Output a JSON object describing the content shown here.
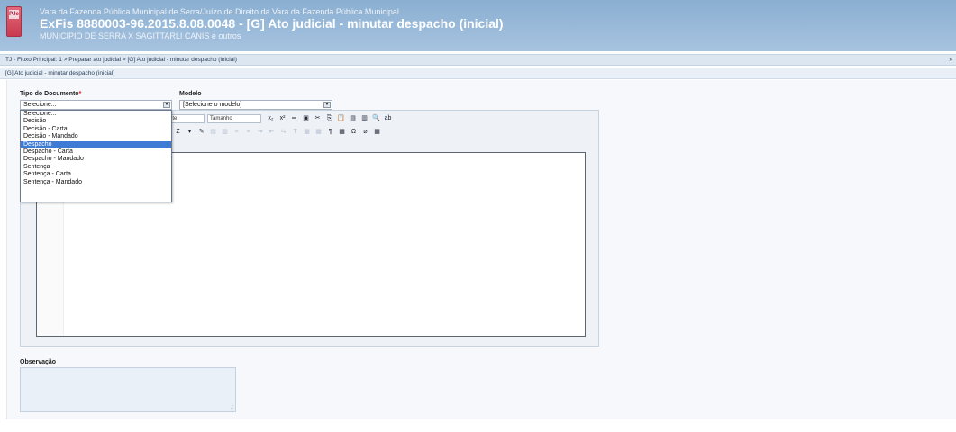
{
  "header": {
    "subtitle": "Vara da Fazenda Pública Municipal de Serra/Juízo de Direito da Vara da Fazenda Pública Municipal",
    "title": "ExFis 8880003-96.2015.8.08.0048 - [G] Ato judicial - minutar despacho (inicial)",
    "parties": "MUNICIPIO DE SERRA X SAGITTARLI CANIS e outros",
    "logo_text": "PJe"
  },
  "breadcrumb": {
    "text": "TJ - Fluxo Principal: 1 > Preparar ato judicial > [G] Ato judicial - minutar despacho (inicial)",
    "more": "»"
  },
  "task_bar": {
    "text": "[G] Ato judicial - minutar despacho (inicial)"
  },
  "form": {
    "tipo_label": "Tipo do Documento",
    "required_mark": "*",
    "tipo_value": "Selecione...",
    "modelo_label": "Modelo",
    "modelo_value": "[Selecione o modelo]",
    "tipo_options": [
      "Selecione...",
      "Decisão",
      "Decisão - Carta",
      "Decisão - Mandado",
      "Despacho",
      "Despacho - Carta",
      "Despacho - Mandado",
      "Sentença",
      "Sentença - Carta",
      "Sentença - Mandado"
    ],
    "highlighted_option": "Despacho",
    "observacao_label": "Observação",
    "resize_grip": ".:"
  },
  "editor_toolbar": {
    "font_combo": "nte",
    "size_combo": "Tamanho",
    "row1_icons": [
      "subscript-icon",
      "superscript-icon",
      "strikethrough-icon",
      "select-all-icon",
      "cut-icon",
      "copy-icon",
      "paste-icon",
      "paste-text-icon",
      "paste-word-icon",
      "find-icon",
      "replace-icon"
    ],
    "row1_glyphs": [
      "x₂",
      "x²",
      "═",
      "▣",
      "✂",
      "⎘",
      "📋",
      "▤",
      "▥",
      "🔍",
      "ab"
    ],
    "row2_glyphs": [
      "Z",
      "▾",
      "✎",
      "▤",
      "▥",
      "≡",
      "≡",
      "⇥",
      "⇤",
      "⇆",
      "T",
      "▦",
      "▦",
      "¶",
      "▦",
      "Ω",
      "⌀",
      "▦"
    ]
  },
  "colors": {
    "accent": "#3d7bd4",
    "header_bg": "#8aafd1"
  }
}
